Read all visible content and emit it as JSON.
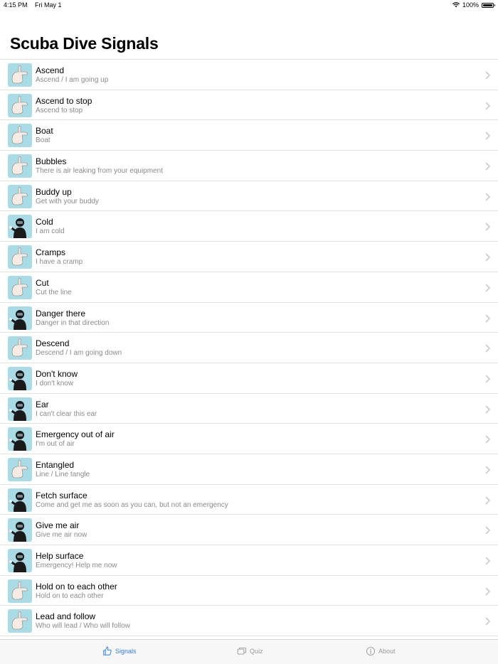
{
  "status_bar": {
    "time": "4:15 PM",
    "date": "Fri May 1",
    "battery": "100%",
    "battery_level": 1.0
  },
  "page_title": "Scuba Dive Signals",
  "signals": [
    {
      "title": "Ascend",
      "subtitle": "Ascend / I am going up",
      "icon": "thumbs-up-hand-icon"
    },
    {
      "title": "Ascend to stop",
      "subtitle": "Ascend to stop",
      "icon": "flat-hand-over-thumb-icon"
    },
    {
      "title": "Boat",
      "subtitle": "Boat",
      "icon": "cupped-hands-icon"
    },
    {
      "title": "Bubbles",
      "subtitle": "There is air leaking from your equipment",
      "icon": "wiggling-fingers-icon"
    },
    {
      "title": "Buddy up",
      "subtitle": "Get with your buddy",
      "icon": "two-fingers-together-icon"
    },
    {
      "title": "Cold",
      "subtitle": "I am cold",
      "icon": "diver-hugging-self-icon"
    },
    {
      "title": "Cramps",
      "subtitle": "I have a cramp",
      "icon": "open-hand-icon"
    },
    {
      "title": "Cut",
      "subtitle": "Cut the line",
      "icon": "scissors-fingers-icon"
    },
    {
      "title": "Danger there",
      "subtitle": "Danger in that direction",
      "icon": "diver-pointing-icon"
    },
    {
      "title": "Descend",
      "subtitle": "Descend / I am going down",
      "icon": "thumbs-down-hand-icon"
    },
    {
      "title": "Don't know",
      "subtitle": "I don't know",
      "icon": "diver-shrug-icon"
    },
    {
      "title": "Ear",
      "subtitle": "I can't clear this ear",
      "icon": "diver-ear-icon"
    },
    {
      "title": "Emergency out of air",
      "subtitle": "I'm out of air",
      "icon": "diver-throat-slash-icon"
    },
    {
      "title": "Entangled",
      "subtitle": "Line / Line tangle",
      "icon": "flat-hand-icon"
    },
    {
      "title": "Fetch surface",
      "subtitle": "Come and get me as soon as you can, but not an emergency",
      "icon": "diver-waving-icon"
    },
    {
      "title": "Give me air",
      "subtitle": "Give me air now",
      "icon": "diver-regulator-icon"
    },
    {
      "title": "Help surface",
      "subtitle": "Emergency! Help me now",
      "icon": "diver-waving-arm-icon"
    },
    {
      "title": "Hold on to each other",
      "subtitle": "Hold on to each other",
      "icon": "clasped-hands-icon"
    },
    {
      "title": "Lead and follow",
      "subtitle": "Who will lead / Who will follow",
      "icon": "hands-one-behind-other-icon"
    }
  ],
  "tabs": [
    {
      "label": "Signals",
      "icon": "thumbs-up-icon",
      "active": true
    },
    {
      "label": "Quiz",
      "icon": "cards-icon",
      "active": false
    },
    {
      "label": "About",
      "icon": "info-icon",
      "active": false
    }
  ],
  "colors": {
    "accent": "#2f7fe0",
    "thumbnail_background": "#a9dbe6",
    "subtitle": "#8a8a8e",
    "separator": "#e2e2e4"
  }
}
